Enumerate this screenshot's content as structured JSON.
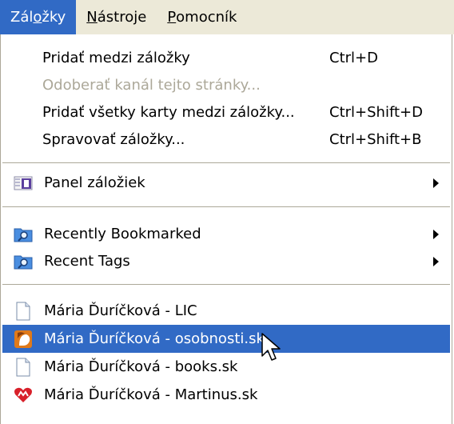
{
  "menubar": {
    "items": [
      {
        "label_pre": "Zál",
        "accel": "o",
        "label_post": "žky"
      },
      {
        "label_pre": "",
        "accel": "N",
        "label_post": "ástroje"
      },
      {
        "label_pre": "",
        "accel": "P",
        "label_post": "omocník"
      }
    ]
  },
  "menu": {
    "items": [
      {
        "label": "Pridať medzi záložky",
        "shortcut": "Ctrl+D"
      },
      {
        "label": "Odoberať kanál tejto stránky...",
        "disabled": true
      },
      {
        "label": "Pridať všetky karty medzi záložky...",
        "shortcut": "Ctrl+Shift+D"
      },
      {
        "label": "Spravovať záložky...",
        "shortcut": "Ctrl+Shift+B"
      },
      {
        "label": "Panel záložiek",
        "icon": "bookmarks-toolbar-icon",
        "submenu": true
      },
      {
        "label": "Recently Bookmarked",
        "icon": "smart-folder-icon",
        "submenu": true
      },
      {
        "label": "Recent Tags",
        "icon": "smart-folder-icon",
        "submenu": true
      },
      {
        "label": "Mária Ďuríčková - LIC",
        "icon": "page-icon"
      },
      {
        "label": "Mária Ďuríčková - osobnosti.sk",
        "icon": "person-favicon-icon",
        "selected": true
      },
      {
        "label": "Mária Ďuríčková - books.sk",
        "icon": "page-icon"
      },
      {
        "label": "Mária Ďuríčková - Martinus.sk",
        "icon": "martinus-favicon-icon"
      }
    ]
  },
  "colors": {
    "menubar_bg": "#ece9d8",
    "highlight": "#316ac5",
    "disabled_text": "#aca899"
  }
}
